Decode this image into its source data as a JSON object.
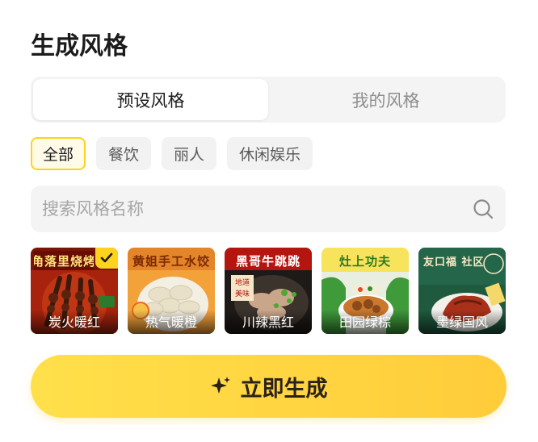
{
  "section_title": "生成风格",
  "segmented": {
    "tabs": [
      {
        "label": "预设风格",
        "active": true
      },
      {
        "label": "我的风格",
        "active": false
      }
    ]
  },
  "categories": {
    "chips": [
      "全部",
      "餐饮",
      "丽人",
      "休闲娱乐"
    ],
    "selected": "全部"
  },
  "search": {
    "placeholder": "搜索风格名称",
    "value": ""
  },
  "styles": [
    {
      "name": "炭火暖红",
      "banner": "角落里烧烤",
      "selected": true,
      "icon": "skewers-image"
    },
    {
      "name": "热气暖橙",
      "banner": "黄姐手工水饺",
      "selected": false,
      "icon": "dumplings-image"
    },
    {
      "name": "川辣黑红",
      "banner": "黑哥牛跳跳",
      "selected": false,
      "icon": "beef-image"
    },
    {
      "name": "田园绿棕",
      "banner": "灶上功夫",
      "selected": false,
      "icon": "braised-dish-image"
    },
    {
      "name": "墨绿国风",
      "banner": "友口福 社区厨房",
      "selected": false,
      "icon": "roast-duck-image"
    }
  ],
  "cta": {
    "label": "立即生成",
    "icon": "sparkle-icon"
  },
  "colors": {
    "accent": "#ffd21e",
    "cta_start": "#ffe04a",
    "cta_end": "#ffcc3a",
    "muted_bg": "#f4f4f5"
  }
}
